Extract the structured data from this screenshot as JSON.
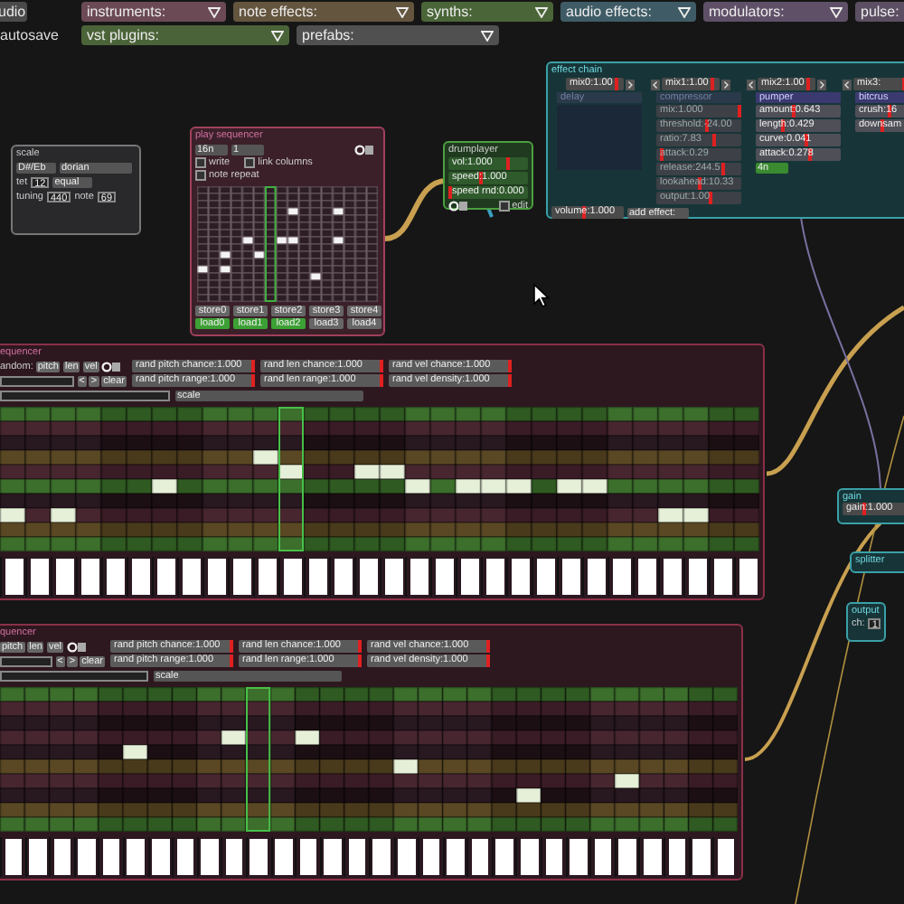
{
  "top_bar": {
    "rows": [
      [
        {
          "kind": "button",
          "text": "udio"
        },
        {
          "kind": "dropdown",
          "text": "instruments:",
          "color": "#6b4a55"
        },
        {
          "kind": "dropdown",
          "text": "note effects:",
          "color": "#64553f"
        },
        {
          "kind": "dropdown",
          "text": "synths:",
          "color": "#4a6638"
        },
        {
          "kind": "dropdown",
          "text": "audio effects:",
          "color": "#3f5c66"
        },
        {
          "kind": "dropdown",
          "text": "modulators:",
          "color": "#5f5068"
        },
        {
          "kind": "dropdown",
          "text": "pulse:",
          "color": "#5c4f63"
        }
      ],
      [
        {
          "kind": "label",
          "text": "autosave"
        },
        {
          "kind": "dropdown",
          "text": "vst plugins:",
          "color": "#4b6338"
        },
        {
          "kind": "dropdown",
          "text": "prefabs:",
          "color": "#505050"
        }
      ]
    ]
  },
  "scale": {
    "title": "scale",
    "root": "D#/Eb",
    "mode": "dorian",
    "tet_label": "tet",
    "tet": "12",
    "tuning_mode": "equal",
    "tuning_label": "tuning",
    "tuning": "440",
    "note_label": "note",
    "note": "69"
  },
  "play_sequencer": {
    "title": "play sequencer",
    "interval": "16n",
    "length": "1",
    "options": [
      {
        "label": "write",
        "checked": false
      },
      {
        "label": "link columns",
        "checked": false
      },
      {
        "label": "note repeat",
        "checked": false
      }
    ],
    "columns": [
      {
        "playing": false,
        "notes": [
          false,
          false,
          false,
          false,
          false,
          false,
          false,
          false,
          false,
          false,
          false,
          true,
          false,
          false,
          false,
          false
        ]
      },
      {
        "playing": false,
        "notes": [
          false,
          false,
          false,
          false,
          false,
          false,
          false,
          false,
          false,
          false,
          false,
          false,
          false,
          false,
          false,
          false
        ]
      },
      {
        "playing": false,
        "notes": [
          false,
          false,
          false,
          false,
          false,
          false,
          false,
          false,
          false,
          true,
          false,
          true,
          false,
          false,
          false,
          false
        ]
      },
      {
        "playing": false,
        "notes": [
          false,
          false,
          false,
          false,
          false,
          false,
          false,
          false,
          false,
          false,
          false,
          false,
          false,
          false,
          false,
          false
        ]
      },
      {
        "playing": false,
        "notes": [
          false,
          false,
          false,
          false,
          false,
          false,
          false,
          true,
          false,
          false,
          false,
          false,
          false,
          false,
          false,
          false
        ]
      },
      {
        "playing": false,
        "notes": [
          false,
          false,
          false,
          false,
          false,
          false,
          false,
          false,
          false,
          true,
          false,
          false,
          false,
          false,
          false,
          false
        ]
      },
      {
        "playing": true,
        "notes": [
          false,
          false,
          false,
          false,
          false,
          false,
          false,
          false,
          false,
          false,
          false,
          false,
          false,
          false,
          false,
          false
        ]
      },
      {
        "playing": false,
        "notes": [
          false,
          false,
          false,
          false,
          false,
          false,
          false,
          true,
          false,
          false,
          false,
          false,
          false,
          false,
          false,
          false
        ]
      },
      {
        "playing": false,
        "notes": [
          false,
          false,
          false,
          true,
          false,
          false,
          false,
          true,
          false,
          false,
          false,
          false,
          false,
          false,
          false,
          false
        ]
      },
      {
        "playing": false,
        "notes": [
          false,
          false,
          false,
          false,
          false,
          false,
          false,
          false,
          false,
          false,
          false,
          false,
          false,
          false,
          false,
          false
        ]
      },
      {
        "playing": false,
        "notes": [
          false,
          false,
          false,
          false,
          false,
          false,
          false,
          false,
          false,
          false,
          false,
          false,
          true,
          false,
          false,
          false
        ]
      },
      {
        "playing": false,
        "notes": [
          false,
          false,
          false,
          false,
          false,
          false,
          false,
          false,
          false,
          false,
          false,
          false,
          false,
          false,
          false,
          false
        ]
      },
      {
        "playing": false,
        "notes": [
          false,
          false,
          false,
          true,
          false,
          false,
          false,
          true,
          false,
          false,
          false,
          false,
          false,
          false,
          false,
          false
        ]
      },
      {
        "playing": false,
        "notes": [
          false,
          false,
          false,
          false,
          false,
          false,
          false,
          false,
          false,
          false,
          false,
          false,
          false,
          false,
          false,
          false
        ]
      },
      {
        "playing": false,
        "notes": [
          false,
          false,
          false,
          false,
          false,
          false,
          false,
          false,
          false,
          false,
          false,
          false,
          false,
          false,
          false,
          false
        ]
      },
      {
        "playing": false,
        "notes": [
          false,
          false,
          false,
          false,
          false,
          false,
          false,
          false,
          false,
          false,
          false,
          false,
          false,
          false,
          false,
          false
        ]
      }
    ],
    "stores": [
      "store0",
      "store1",
      "store2",
      "store3",
      "store4"
    ],
    "loads": [
      {
        "label": "load0",
        "filled": true
      },
      {
        "label": "load1",
        "filled": true
      },
      {
        "label": "load2",
        "filled": true
      },
      {
        "label": "load3",
        "filled": false
      },
      {
        "label": "load4",
        "filled": false
      }
    ]
  },
  "drumplayer": {
    "title": "drumplayer",
    "sliders": [
      {
        "text": "vol:1.000",
        "level": 0.75
      },
      {
        "text": "speed:1.000",
        "level": 0.4
      },
      {
        "text": "speed rnd:0.000",
        "level": 0
      }
    ],
    "edit": {
      "label": "edit",
      "checked": false
    }
  },
  "effect_chain": {
    "title": "effect chain",
    "mixes": [
      {
        "text": "mix0:1.00",
        "level": 0.9
      },
      {
        "text": "mix1:1.00",
        "level": 0.9
      },
      {
        "text": "mix2:1.00",
        "level": 0.9
      },
      {
        "text": "mix3:",
        "level": 0.9
      }
    ],
    "effects": [
      {
        "name": "delay",
        "enabled": false
      },
      {
        "name": "compressor",
        "enabled": false,
        "params": [
          {
            "text": "mix:1.000",
            "level": 1
          },
          {
            "text": "threshold:-24.00",
            "level": 0.6
          },
          {
            "text": "ratio:7.83",
            "level": 0.7
          },
          {
            "text": "attack:0.29",
            "level": 0.05
          },
          {
            "text": "release:244.5",
            "level": 0.8
          },
          {
            "text": "lookahead:10.33",
            "level": 0.5
          },
          {
            "text": "output:1.00",
            "level": 0.65
          }
        ]
      },
      {
        "name": "pumper",
        "enabled": true,
        "params": [
          {
            "text": "amount:0.643",
            "level": 0.45
          },
          {
            "text": "length:0.429",
            "level": 0.3
          },
          {
            "text": "curve:0.041",
            "level": 0.6
          },
          {
            "text": "attack:0.278",
            "level": 0.65
          }
        ],
        "mode": "4n"
      },
      {
        "name": "bitcrus",
        "enabled": true,
        "params": [
          {
            "text": "crush:16",
            "level": 0.4
          },
          {
            "text": "downsam",
            "level": 0.3
          }
        ]
      }
    ],
    "volume": {
      "text": "volume:1.000",
      "level": 0.45
    },
    "add_effect": "add effect:"
  },
  "sequencers": [
    {
      "title": "equencer",
      "random_label": "andom:",
      "random_buttons": [
        "pitch",
        "len",
        "vel"
      ],
      "sliders": [
        {
          "text": "rand pitch chance:1.000",
          "level": 1
        },
        {
          "text": "rand len chance:1.000",
          "level": 1
        },
        {
          "text": "rand vel chance:1.000",
          "level": 1
        },
        {
          "text": "rand pitch range:1.000",
          "level": 1
        },
        {
          "text": "rand len range:1.000",
          "level": 1
        },
        {
          "text": "rand vel density:1.000",
          "level": 1
        }
      ],
      "nav": [
        "<",
        ">",
        "clear"
      ],
      "scale": "scale",
      "rows": [
        {
          "kind": "root"
        },
        {
          "kind": "scale"
        },
        {
          "kind": "off"
        },
        {
          "kind": "fifth"
        },
        {
          "kind": "scale"
        },
        {
          "kind": "root"
        },
        {
          "kind": "off"
        },
        {
          "kind": "scale"
        },
        {
          "kind": "fifth"
        },
        {
          "kind": "root"
        }
      ],
      "columns": [
        {
          "playing": false,
          "level": 1,
          "notes": [
            false,
            false,
            false,
            false,
            false,
            false,
            false,
            true,
            false,
            false
          ]
        },
        {
          "playing": false,
          "level": 1,
          "notes": [
            false,
            false,
            false,
            false,
            false,
            false,
            false,
            false,
            false,
            false
          ]
        },
        {
          "playing": false,
          "level": 1,
          "notes": [
            false,
            false,
            false,
            false,
            false,
            false,
            false,
            true,
            false,
            false
          ]
        },
        {
          "playing": false,
          "level": 1,
          "notes": [
            false,
            false,
            false,
            false,
            false,
            false,
            false,
            false,
            false,
            false
          ]
        },
        {
          "playing": false,
          "level": 1,
          "notes": [
            false,
            false,
            false,
            false,
            false,
            false,
            false,
            false,
            false,
            false
          ]
        },
        {
          "playing": false,
          "level": 1,
          "notes": [
            false,
            false,
            false,
            false,
            false,
            false,
            false,
            false,
            false,
            false
          ]
        },
        {
          "playing": false,
          "level": 1,
          "notes": [
            false,
            false,
            false,
            false,
            false,
            true,
            false,
            false,
            false,
            false
          ]
        },
        {
          "playing": false,
          "level": 1,
          "notes": [
            false,
            false,
            false,
            false,
            false,
            false,
            false,
            false,
            false,
            false
          ]
        },
        {
          "playing": false,
          "level": 1,
          "notes": [
            false,
            false,
            false,
            false,
            false,
            false,
            false,
            false,
            false,
            false
          ]
        },
        {
          "playing": false,
          "level": 1,
          "notes": [
            false,
            false,
            false,
            false,
            false,
            false,
            false,
            false,
            false,
            false
          ]
        },
        {
          "playing": false,
          "level": 1,
          "notes": [
            false,
            false,
            false,
            true,
            false,
            false,
            false,
            false,
            false,
            false
          ]
        },
        {
          "playing": true,
          "level": 1,
          "notes": [
            false,
            false,
            false,
            false,
            true,
            false,
            false,
            false,
            false,
            false
          ]
        },
        {
          "playing": false,
          "level": 1,
          "notes": [
            false,
            false,
            false,
            false,
            false,
            false,
            false,
            false,
            false,
            false
          ]
        },
        {
          "playing": false,
          "level": 1,
          "notes": [
            false,
            false,
            false,
            false,
            false,
            false,
            false,
            false,
            false,
            false
          ]
        },
        {
          "playing": false,
          "level": 1,
          "notes": [
            false,
            false,
            false,
            false,
            true,
            false,
            false,
            false,
            false,
            false
          ]
        },
        {
          "playing": false,
          "level": 1,
          "notes": [
            false,
            false,
            false,
            false,
            true,
            false,
            false,
            false,
            false,
            false
          ]
        },
        {
          "playing": false,
          "level": 1,
          "notes": [
            false,
            false,
            false,
            false,
            false,
            true,
            false,
            false,
            false,
            false
          ]
        },
        {
          "playing": false,
          "level": 1,
          "notes": [
            false,
            false,
            false,
            false,
            false,
            false,
            false,
            false,
            false,
            false
          ]
        },
        {
          "playing": false,
          "level": 1,
          "notes": [
            false,
            false,
            false,
            false,
            false,
            true,
            false,
            false,
            false,
            false
          ]
        },
        {
          "playing": false,
          "level": 1,
          "notes": [
            false,
            false,
            false,
            false,
            false,
            true,
            false,
            false,
            false,
            false
          ]
        },
        {
          "playing": false,
          "level": 1,
          "notes": [
            false,
            false,
            false,
            false,
            false,
            true,
            false,
            false,
            false,
            false
          ]
        },
        {
          "playing": false,
          "level": 1,
          "notes": [
            false,
            false,
            false,
            false,
            false,
            false,
            false,
            false,
            false,
            false
          ]
        },
        {
          "playing": false,
          "level": 1,
          "notes": [
            false,
            false,
            false,
            false,
            false,
            true,
            false,
            false,
            false,
            false
          ]
        },
        {
          "playing": false,
          "level": 1,
          "notes": [
            false,
            false,
            false,
            false,
            false,
            true,
            false,
            false,
            false,
            false
          ]
        },
        {
          "playing": false,
          "level": 1,
          "notes": [
            false,
            false,
            false,
            false,
            false,
            false,
            false,
            false,
            false,
            false
          ]
        },
        {
          "playing": false,
          "level": 1,
          "notes": [
            false,
            false,
            false,
            false,
            false,
            false,
            false,
            false,
            false,
            false
          ]
        },
        {
          "playing": false,
          "level": 1,
          "notes": [
            false,
            false,
            false,
            false,
            false,
            false,
            false,
            true,
            false,
            false
          ]
        },
        {
          "playing": false,
          "level": 1,
          "notes": [
            false,
            false,
            false,
            false,
            false,
            false,
            false,
            true,
            false,
            false
          ]
        },
        {
          "playing": false,
          "level": 1,
          "notes": [
            false,
            false,
            false,
            false,
            false,
            false,
            false,
            false,
            false,
            false
          ]
        },
        {
          "playing": false,
          "level": 1,
          "notes": [
            false,
            false,
            false,
            false,
            false,
            false,
            false,
            false,
            false,
            false
          ]
        }
      ]
    },
    {
      "title": "quencer",
      "random_buttons": [
        "pitch",
        "len",
        "vel"
      ],
      "sliders": [
        {
          "text": "rand pitch chance:1.000",
          "level": 1
        },
        {
          "text": "rand len chance:1.000",
          "level": 1
        },
        {
          "text": "rand vel chance:1.000",
          "level": 1
        },
        {
          "text": "rand pitch range:1.000",
          "level": 1
        },
        {
          "text": "rand len range:1.000",
          "level": 1
        },
        {
          "text": "rand vel density:1.000",
          "level": 1
        }
      ],
      "nav": [
        "<",
        ">",
        "clear"
      ],
      "scale": "scale",
      "rows": [
        {
          "kind": "root"
        },
        {
          "kind": "scale"
        },
        {
          "kind": "off"
        },
        {
          "kind": "scale"
        },
        {
          "kind": "off"
        },
        {
          "kind": "fifth"
        },
        {
          "kind": "scale"
        },
        {
          "kind": "off"
        },
        {
          "kind": "fifth"
        },
        {
          "kind": "root"
        }
      ],
      "columns": [
        {
          "playing": false,
          "level": 1,
          "notes": [
            false,
            false,
            false,
            false,
            false,
            false,
            false,
            false,
            false,
            false
          ]
        },
        {
          "playing": false,
          "level": 1,
          "notes": [
            false,
            false,
            false,
            false,
            false,
            false,
            false,
            false,
            false,
            false
          ]
        },
        {
          "playing": false,
          "level": 1,
          "notes": [
            false,
            false,
            false,
            false,
            false,
            false,
            false,
            false,
            false,
            false
          ]
        },
        {
          "playing": false,
          "level": 1,
          "notes": [
            false,
            false,
            false,
            false,
            false,
            false,
            false,
            false,
            false,
            false
          ]
        },
        {
          "playing": false,
          "level": 1,
          "notes": [
            false,
            false,
            false,
            false,
            false,
            false,
            false,
            false,
            false,
            false
          ]
        },
        {
          "playing": false,
          "level": 1,
          "notes": [
            false,
            false,
            false,
            false,
            true,
            false,
            false,
            false,
            false,
            false
          ]
        },
        {
          "playing": false,
          "level": 1,
          "notes": [
            false,
            false,
            false,
            false,
            false,
            false,
            false,
            false,
            false,
            false
          ]
        },
        {
          "playing": false,
          "level": 1,
          "notes": [
            false,
            false,
            false,
            false,
            false,
            false,
            false,
            false,
            false,
            false
          ]
        },
        {
          "playing": false,
          "level": 1,
          "notes": [
            false,
            false,
            false,
            false,
            false,
            false,
            false,
            false,
            false,
            false
          ]
        },
        {
          "playing": false,
          "level": 1,
          "notes": [
            false,
            false,
            false,
            true,
            false,
            false,
            false,
            false,
            false,
            false
          ]
        },
        {
          "playing": true,
          "level": 1,
          "notes": [
            false,
            false,
            false,
            false,
            false,
            false,
            false,
            false,
            false,
            false
          ]
        },
        {
          "playing": false,
          "level": 1,
          "notes": [
            false,
            false,
            false,
            false,
            false,
            false,
            false,
            false,
            false,
            false
          ]
        },
        {
          "playing": false,
          "level": 1,
          "notes": [
            false,
            false,
            false,
            true,
            false,
            false,
            false,
            false,
            false,
            false
          ]
        },
        {
          "playing": false,
          "level": 1,
          "notes": [
            false,
            false,
            false,
            false,
            false,
            false,
            false,
            false,
            false,
            false
          ]
        },
        {
          "playing": false,
          "level": 1,
          "notes": [
            false,
            false,
            false,
            false,
            false,
            false,
            false,
            false,
            false,
            false
          ]
        },
        {
          "playing": false,
          "level": 1,
          "notes": [
            false,
            false,
            false,
            false,
            false,
            false,
            false,
            false,
            false,
            false
          ]
        },
        {
          "playing": false,
          "level": 1,
          "notes": [
            false,
            false,
            false,
            false,
            false,
            true,
            false,
            false,
            false,
            false
          ]
        },
        {
          "playing": false,
          "level": 1,
          "notes": [
            false,
            false,
            false,
            false,
            false,
            false,
            false,
            false,
            false,
            false
          ]
        },
        {
          "playing": false,
          "level": 1,
          "notes": [
            false,
            false,
            false,
            false,
            false,
            false,
            false,
            false,
            false,
            false
          ]
        },
        {
          "playing": false,
          "level": 1,
          "notes": [
            false,
            false,
            false,
            false,
            false,
            false,
            false,
            false,
            false,
            false
          ]
        },
        {
          "playing": false,
          "level": 1,
          "notes": [
            false,
            false,
            false,
            false,
            false,
            false,
            false,
            false,
            false,
            false
          ]
        },
        {
          "playing": false,
          "level": 1,
          "notes": [
            false,
            false,
            false,
            false,
            false,
            false,
            false,
            true,
            false,
            false
          ]
        },
        {
          "playing": false,
          "level": 1,
          "notes": [
            false,
            false,
            false,
            false,
            false,
            false,
            false,
            false,
            false,
            false
          ]
        },
        {
          "playing": false,
          "level": 1,
          "notes": [
            false,
            false,
            false,
            false,
            false,
            false,
            false,
            false,
            false,
            false
          ]
        },
        {
          "playing": false,
          "level": 1,
          "notes": [
            false,
            false,
            false,
            false,
            false,
            false,
            false,
            false,
            false,
            false
          ]
        },
        {
          "playing": false,
          "level": 1,
          "notes": [
            false,
            false,
            false,
            false,
            false,
            false,
            true,
            false,
            false,
            false
          ]
        },
        {
          "playing": false,
          "level": 1,
          "notes": [
            false,
            false,
            false,
            false,
            false,
            false,
            false,
            false,
            false,
            false
          ]
        },
        {
          "playing": false,
          "level": 1,
          "notes": [
            false,
            false,
            false,
            false,
            false,
            false,
            false,
            false,
            false,
            false
          ]
        },
        {
          "playing": false,
          "level": 1,
          "notes": [
            false,
            false,
            false,
            false,
            false,
            false,
            false,
            false,
            false,
            false
          ]
        },
        {
          "playing": false,
          "level": 1,
          "notes": [
            false,
            false,
            false,
            false,
            false,
            false,
            false,
            false,
            false,
            false
          ]
        }
      ]
    }
  ],
  "gain": {
    "title": "gain",
    "slider": {
      "text": "gain:1.000",
      "level": 0.3
    }
  },
  "splitter": {
    "title": "splitter"
  },
  "output": {
    "title": "output",
    "ch_label": "ch:",
    "ch": "1"
  }
}
